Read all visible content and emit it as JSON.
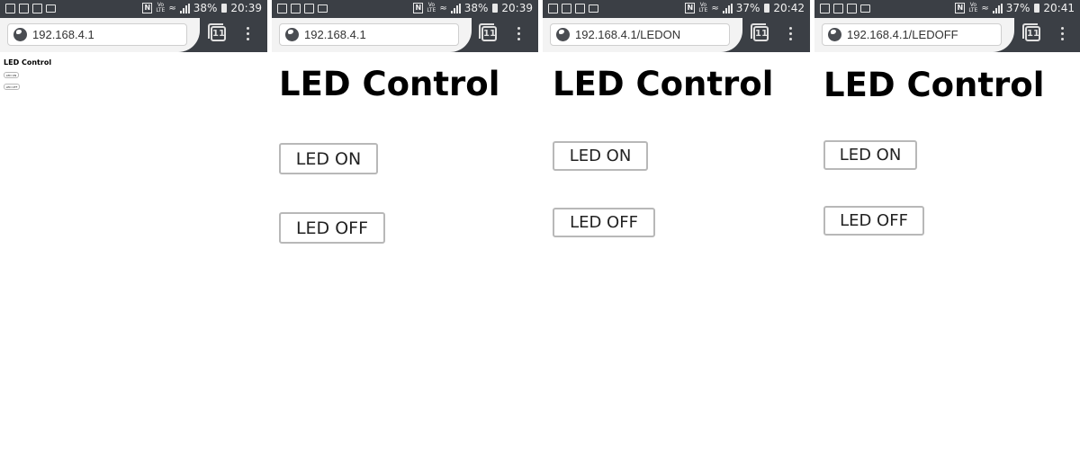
{
  "panels": [
    {
      "status": {
        "battery": "38%",
        "time": "20:39"
      },
      "url": "192.168.4.1",
      "tab_count": "11",
      "page": {
        "heading": "LED Control",
        "on_label": "LED ON",
        "off_label": "LED OFF"
      }
    },
    {
      "status": {
        "battery": "38%",
        "time": "20:39"
      },
      "url": "192.168.4.1",
      "tab_count": "11",
      "page": {
        "heading": "LED Control",
        "on_label": "LED ON",
        "off_label": "LED OFF"
      }
    },
    {
      "status": {
        "battery": "37%",
        "time": "20:42"
      },
      "url": "192.168.4.1/LEDON",
      "tab_count": "11",
      "page": {
        "heading": "LED Control",
        "on_label": "LED ON",
        "off_label": "LED OFF"
      }
    },
    {
      "status": {
        "battery": "37%",
        "time": "20:41"
      },
      "url": "192.168.4.1/LEDOFF",
      "tab_count": "11",
      "page": {
        "heading": "LED Control",
        "on_label": "LED ON",
        "off_label": "LED OFF"
      }
    }
  ],
  "status_icons": [
    "nfc-icon",
    "volte-icon",
    "wifi-icon",
    "signal-icon",
    "battery-icon"
  ],
  "colors": {
    "chrome_bar": "#3b3f45",
    "url_bar": "#f3f3f3",
    "page_bg": "#ffffff",
    "button_border": "#b8b8b8"
  }
}
